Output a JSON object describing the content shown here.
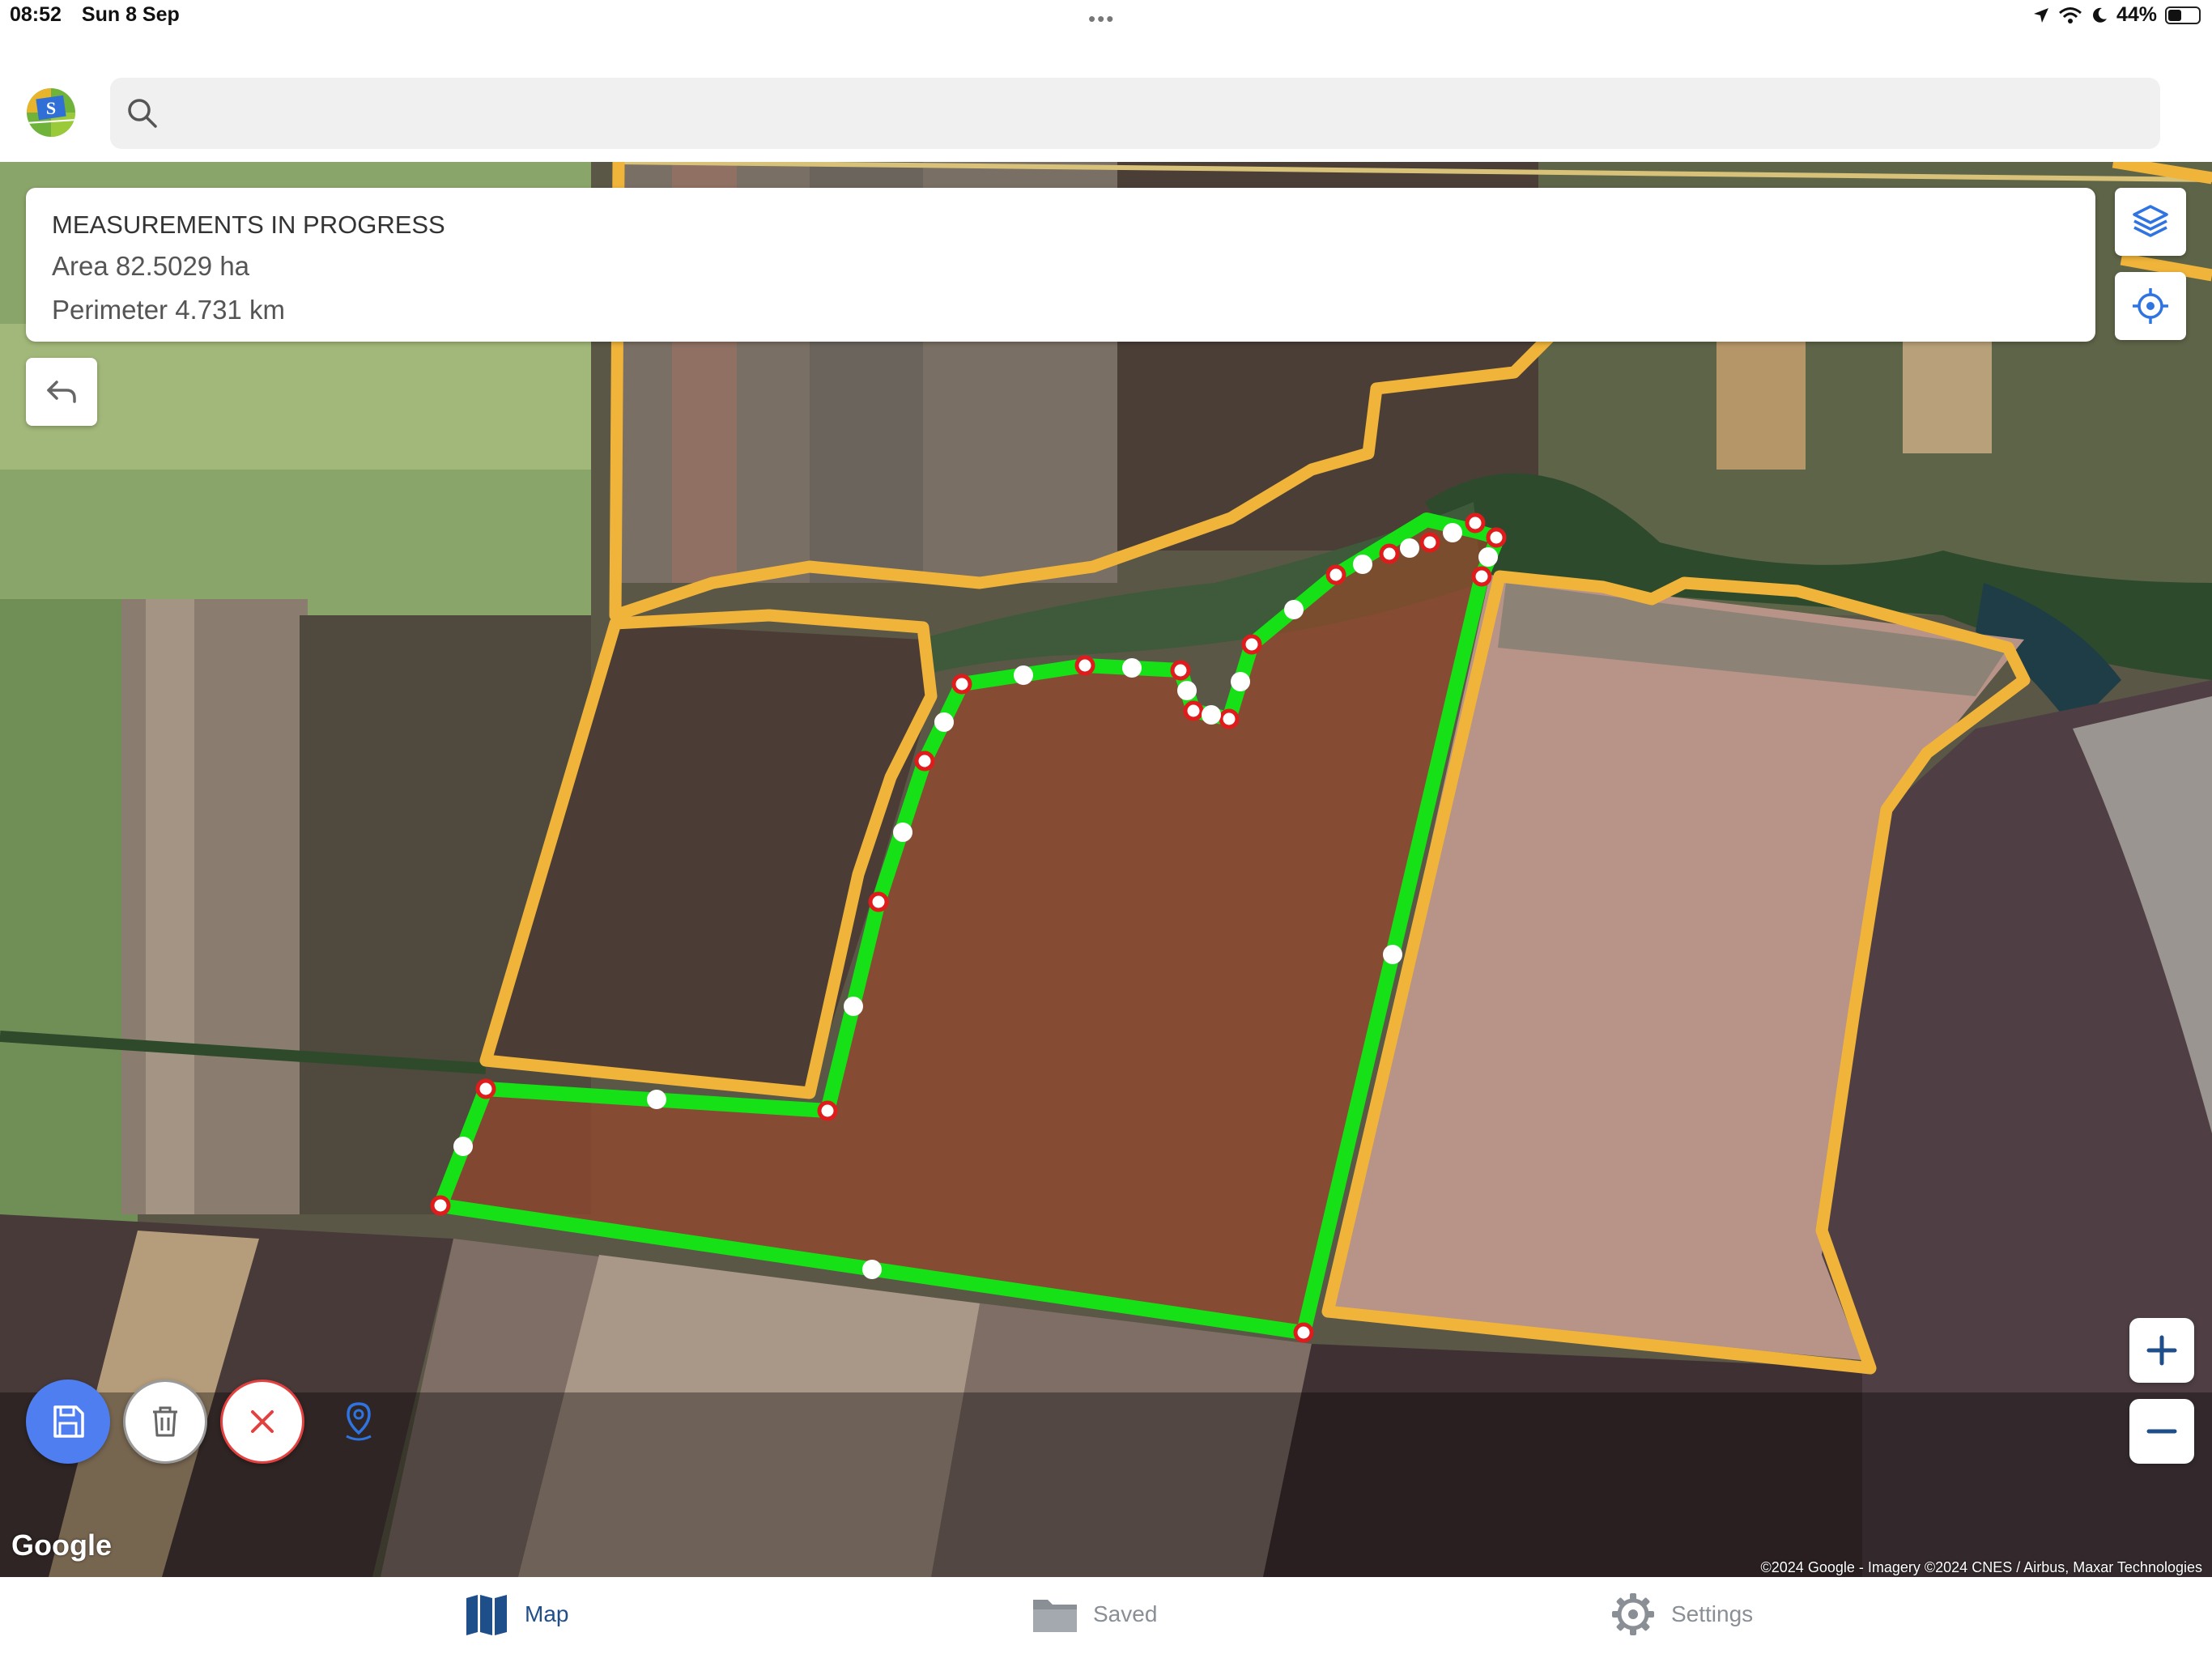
{
  "status_bar": {
    "time": "08:52",
    "date": "Sun 8 Sep",
    "battery": "44%",
    "battery_level": 0.44
  },
  "search": {
    "placeholder": "",
    "value": ""
  },
  "measurement": {
    "title": "MEASUREMENTS IN PROGRESS",
    "area": "Area 82.5029 ha",
    "perimeter": "Perimeter 4.731 km"
  },
  "map": {
    "attribution": "©2024 Google - Imagery ©2024 CNES / Airbus, Maxar Technologies",
    "provider_logo": "Google"
  },
  "tabs": [
    {
      "label": "Map",
      "icon": "map-icon",
      "active": true
    },
    {
      "label": "Saved",
      "icon": "folder-icon",
      "active": false
    },
    {
      "label": "Settings",
      "icon": "gear-icon",
      "active": false
    }
  ],
  "colors": {
    "measurement_line": "#16e016",
    "field_boundary": "#f0b43a",
    "vertex_marker": "#e01b1b",
    "save_button": "#4f7ef0",
    "cancel_red": "#e34040",
    "active_tab": "#1f4f8a",
    "inactive_tab": "#8a8f96"
  },
  "icons": {
    "layers": "layers-icon",
    "locate": "locate-icon",
    "undo": "undo-icon",
    "save": "save-icon",
    "delete": "trash-icon",
    "cancel": "close-icon",
    "pin": "location-pin-icon",
    "zoom_in": "plus-icon",
    "zoom_out": "minus-icon",
    "search": "search-icon"
  }
}
